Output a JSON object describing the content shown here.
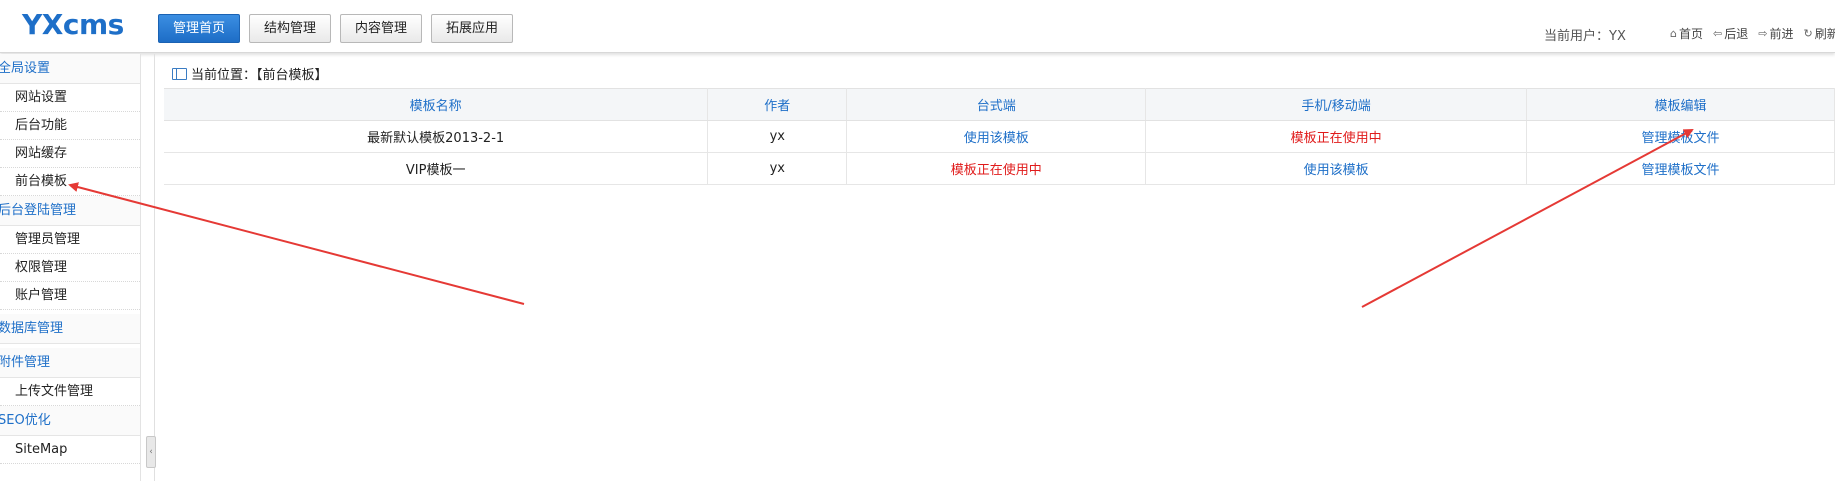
{
  "header": {
    "logo": "YXcms",
    "nav": [
      "管理首页",
      "结构管理",
      "内容管理",
      "拓展应用"
    ],
    "current_user": "当前用户：YX",
    "tools": [
      {
        "icon": "home-icon",
        "label": "首页"
      },
      {
        "icon": "back-arrow-icon",
        "label": "后退"
      },
      {
        "icon": "forward-arrow-icon",
        "label": "前进"
      },
      {
        "icon": "refresh-icon",
        "label": "刷新"
      }
    ]
  },
  "sidebar": {
    "groups": [
      {
        "title": "全局设置",
        "items": [
          "网站设置",
          "后台功能",
          "网站缓存",
          "前台模板"
        ]
      },
      {
        "title": "后台登陆管理",
        "items": [
          "管理员管理",
          "权限管理",
          "账户管理"
        ]
      },
      {
        "title": "数据库管理",
        "items": []
      },
      {
        "title": "附件管理",
        "items": [
          "上传文件管理"
        ]
      },
      {
        "title": "SEO优化",
        "items": [
          "SiteMap"
        ]
      }
    ]
  },
  "breadcrumb": "当前位置：【前台模板】",
  "table": {
    "headers": [
      "模板名称",
      "作者",
      "台式端",
      "手机/移动端",
      "模板编辑"
    ],
    "rows": [
      {
        "name": "最新默认模板2013-2-1",
        "author": "yx",
        "desktop": "使用该模板",
        "mobile": "模板正在使用中",
        "edit": "管理模板文件"
      },
      {
        "name": "VIP模板一",
        "author": "yx",
        "desktop": "模板正在使用中",
        "mobile": "使用该模板",
        "edit": "管理模板文件"
      }
    ]
  },
  "colors": {
    "accent": "#1e6fc8",
    "in_use": "#e01b1b",
    "annotation_arrow": "#e53935"
  }
}
